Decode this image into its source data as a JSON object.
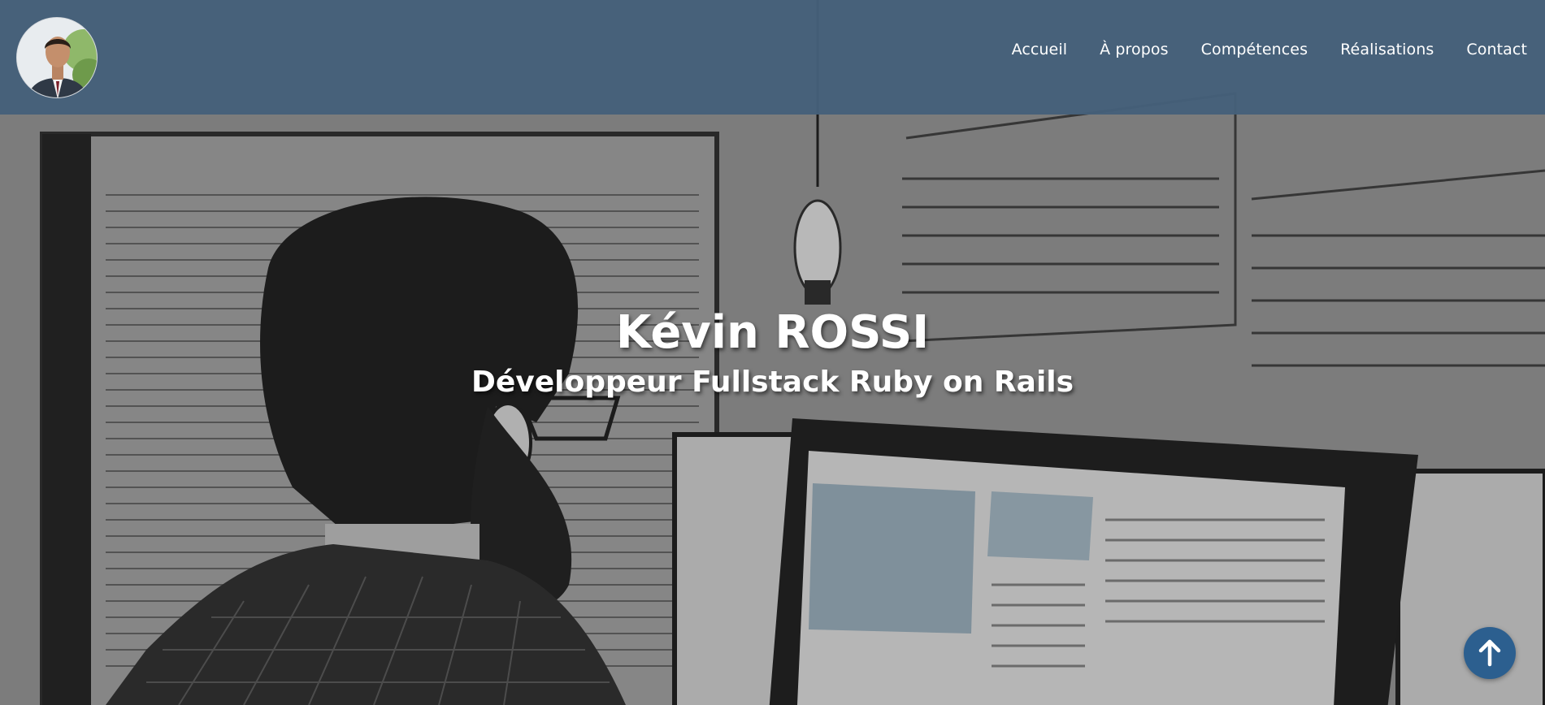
{
  "header": {
    "nav": [
      {
        "label": "Accueil"
      },
      {
        "label": "À propos"
      },
      {
        "label": "Compétences"
      },
      {
        "label": "Réalisations"
      },
      {
        "label": "Contact"
      }
    ]
  },
  "hero": {
    "title": "Kévin ROSSI",
    "subtitle": "Développeur Fullstack Ruby on Rails"
  },
  "colors": {
    "header_bg": "#45607a",
    "back_to_top_bg": "#2c5f8f",
    "text": "#ffffff"
  },
  "icons": {
    "back_to_top": "arrow-up-icon",
    "avatar": "profile-photo"
  }
}
